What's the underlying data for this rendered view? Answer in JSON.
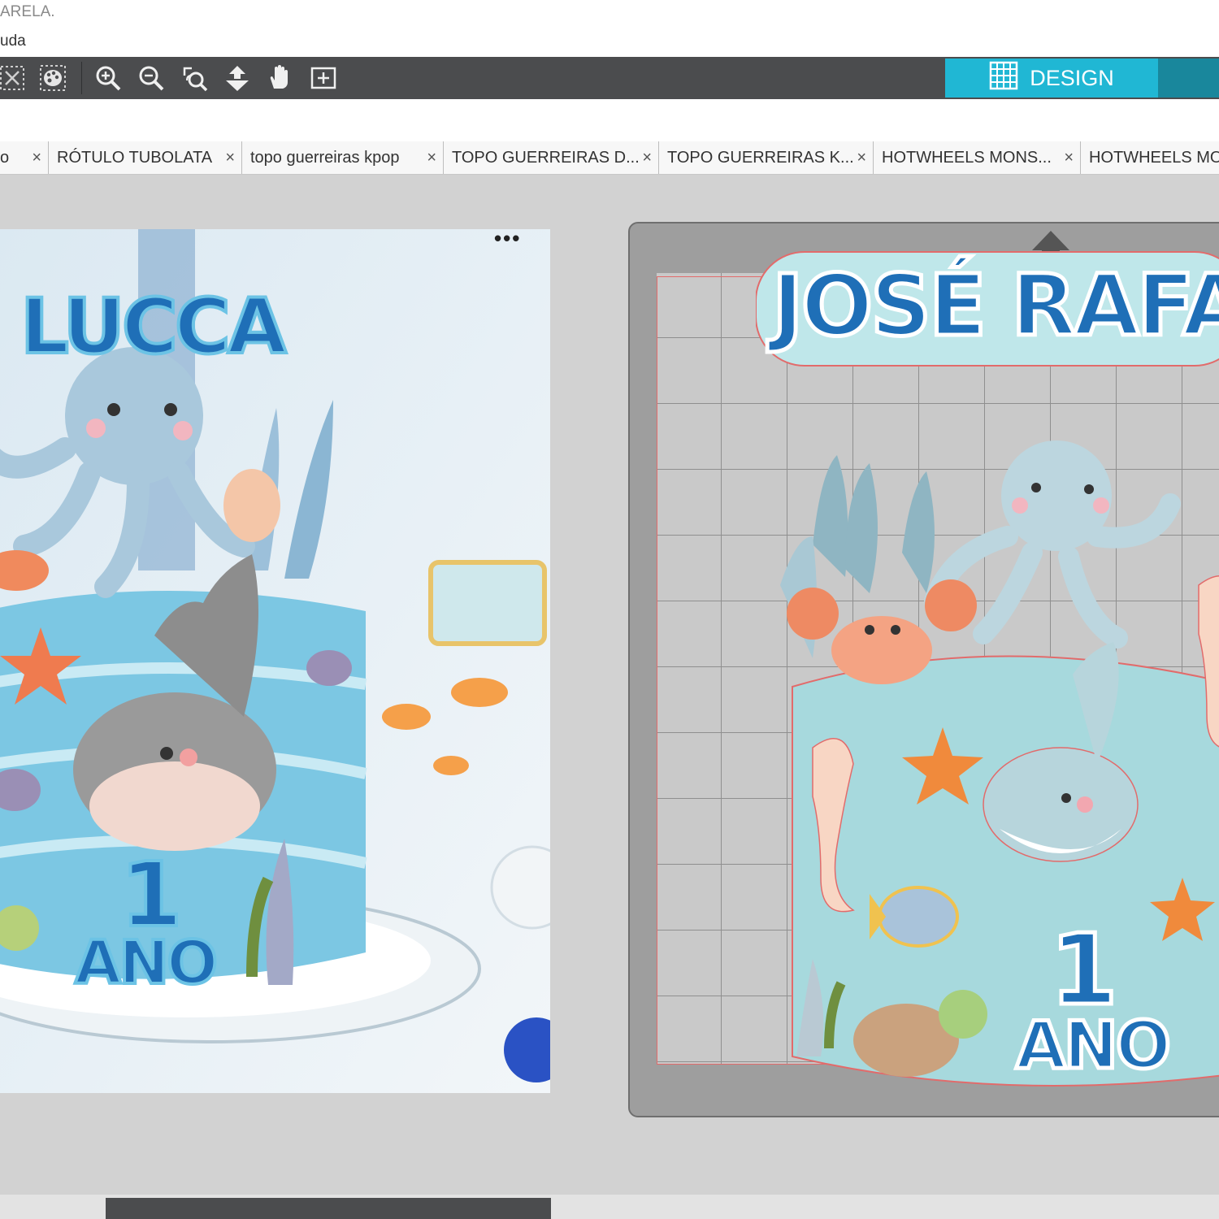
{
  "window": {
    "title_fragment": "ARELA.",
    "menu_fragment": "uda"
  },
  "toolbar": {
    "icons": [
      "close-x-icon",
      "paint-palette-icon",
      "zoom-in-icon",
      "zoom-out-icon",
      "zoom-selection-icon",
      "move-down-icon",
      "hand-pan-icon",
      "fit-page-icon"
    ],
    "design_tab": {
      "label": "DESIGN",
      "color": "#20b7d4"
    }
  },
  "tabs": [
    {
      "label": "o"
    },
    {
      "label": "RÓTULO TUBOLATA"
    },
    {
      "label": "topo guerreiras kpop"
    },
    {
      "label": "TOPO GUERREIRAS D..."
    },
    {
      "label": "TOPO GUERREIRAS K..."
    },
    {
      "label": "HOTWHEELS MONS..."
    },
    {
      "label": "HOTWHEELS MO"
    }
  ],
  "tab_close_glyph": "×",
  "photo": {
    "name_text": "LUCCA",
    "age_number": "1",
    "age_word": "ANO",
    "menu_dots": "•••"
  },
  "design": {
    "name_text": "JOSÉ RAFA",
    "age_number": "1",
    "age_word": "ANO"
  }
}
